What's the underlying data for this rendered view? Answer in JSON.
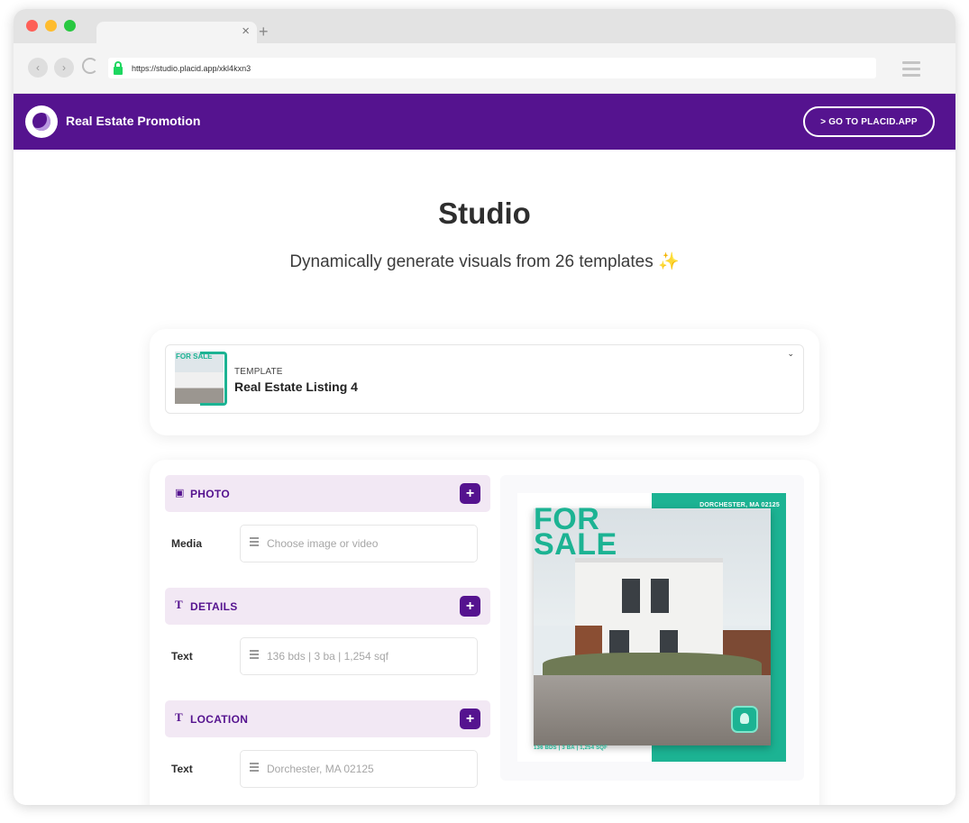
{
  "browser": {
    "url": "https://studio.placid.app/xkl4kxn3",
    "tab_close": "×",
    "tab_new": "+"
  },
  "header": {
    "title": "Real Estate Promotion",
    "cta_label": "> GO TO PLACID.APP"
  },
  "page": {
    "title": "Studio",
    "subtitle": "Dynamically generate visuals from 26 templates",
    "sparkle": "✨"
  },
  "template_select": {
    "label": "TEMPLATE",
    "value": "Real Estate Listing 4",
    "chevron": "⌄"
  },
  "sections": [
    {
      "title": "PHOTO",
      "icon": "image-icon",
      "field_label": "Media",
      "placeholder": "Choose image or video"
    },
    {
      "title": "DETAILS",
      "icon": "text-icon",
      "field_label": "Text",
      "placeholder": "136 bds | 3 ba | 1,254 sqf"
    },
    {
      "title": "LOCATION",
      "icon": "text-icon",
      "field_label": "Text",
      "placeholder": "Dorchester, MA 02125"
    }
  ],
  "preview": {
    "headline": "FOR SALE",
    "location": "DORCHESTER, MA 02125",
    "details": "136 BDS | 3 BA | 1,254 SQF"
  },
  "colors": {
    "brand": "#55138f",
    "accent": "#1cb393",
    "section_bg": "#f2e8f4"
  }
}
